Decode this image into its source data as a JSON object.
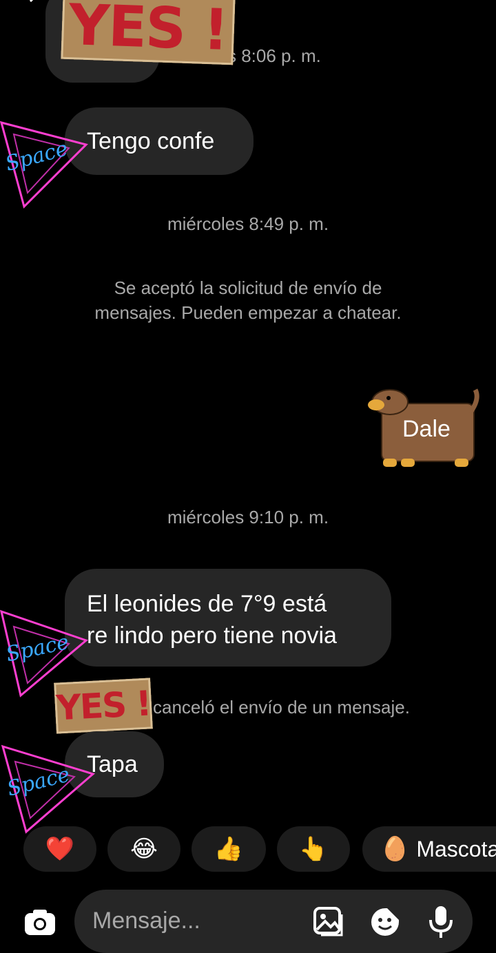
{
  "header": {
    "back_icon": "chevron-left-icon"
  },
  "stickers": {
    "yes_text": "YES !",
    "space_text": "Space"
  },
  "messages": {
    "partial_timestamp": "s 8:06 p. m.",
    "msg1": "Tengo confe",
    "ts2": "miércoles 8:49 p. m.",
    "system_accept": "Se aceptó la solicitud de envío de mensajes. Pueden empezar a chatear.",
    "dale": "Dale",
    "ts3": "miércoles 9:10 p. m.",
    "msg2_line1": "El leonides de 7°9 está",
    "msg2_line2": "re lindo pero tiene novia",
    "cancel_notice": "canceló el envío de un mensaje.",
    "msg3": "Tapa"
  },
  "quick_reactions": {
    "r1": "❤️",
    "r2": "😂",
    "r3": "👍",
    "r4": "👆",
    "pet_icon": "🥚",
    "pet_label": "Mascota"
  },
  "composer": {
    "placeholder": "Mensaje...",
    "icons": [
      "camera-icon",
      "gallery-icon",
      "sticker-icon",
      "microphone-icon"
    ]
  },
  "colors": {
    "bubble": "#262626",
    "meta_text": "#a8a8a8",
    "dog_sticker": "#8b5e3c",
    "neon_pink": "#ff3fd0",
    "neon_blue": "#3aa8ff"
  }
}
